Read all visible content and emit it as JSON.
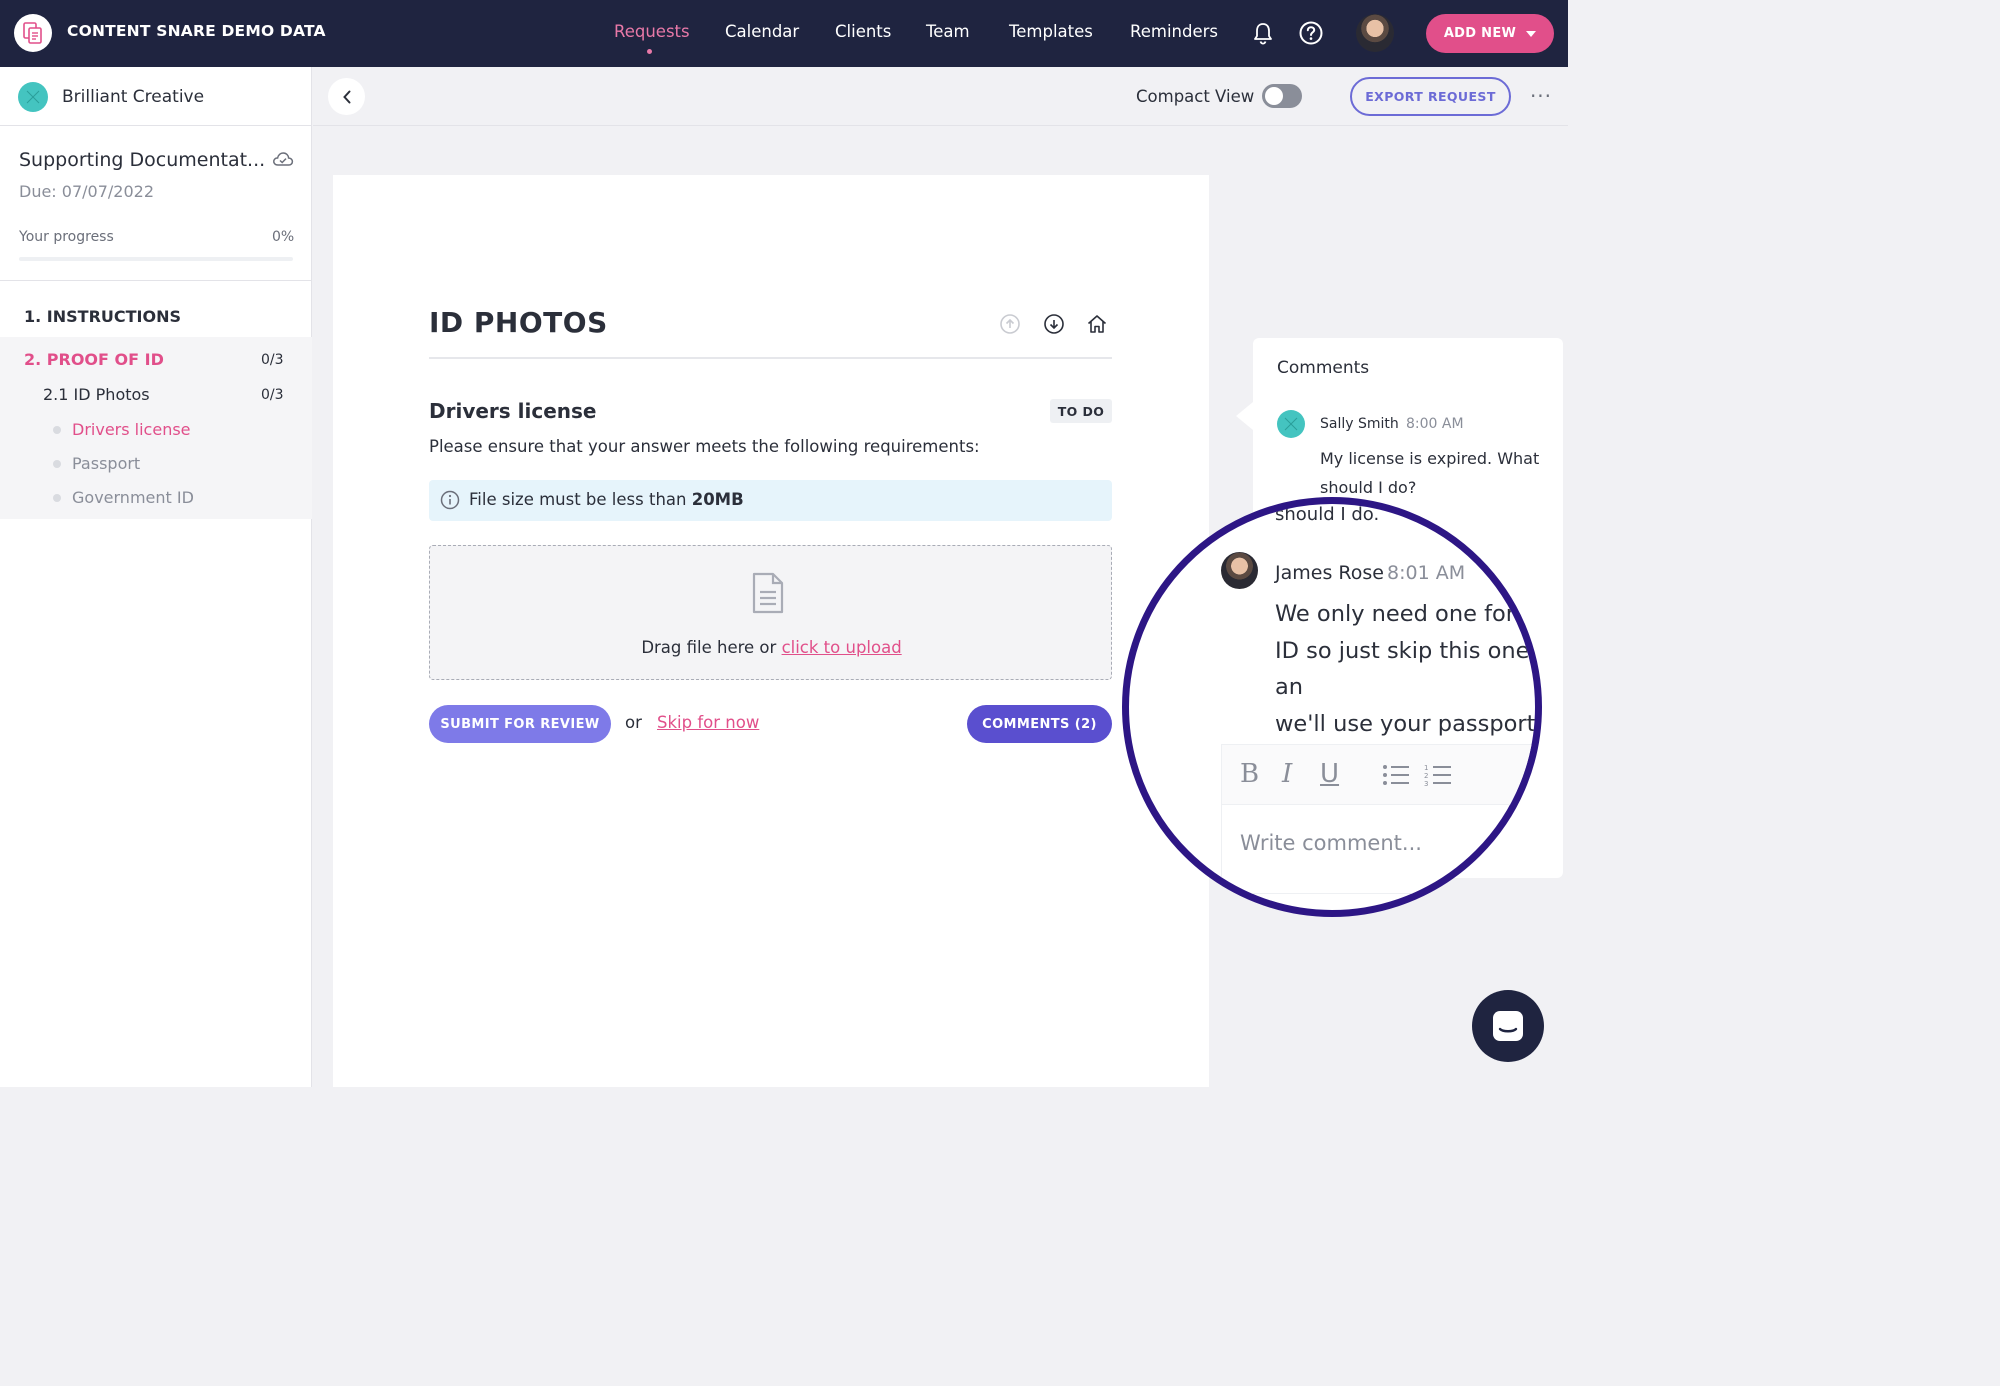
{
  "topnav": {
    "app_title": "CONTENT SNARE DEMO DATA",
    "links": [
      "Requests",
      "Calendar",
      "Clients",
      "Team",
      "Templates",
      "Reminders"
    ],
    "active_link": "Requests",
    "add_new_label": "ADD NEW",
    "icons": [
      "bell-icon",
      "help-icon"
    ]
  },
  "sidebar": {
    "client_name": "Brilliant Creative",
    "request_title": "Supporting Documentat...",
    "due": "Due: 07/07/2022",
    "progress_label": "Your progress",
    "progress_value": "0%",
    "progress_fraction": 0,
    "sections": [
      {
        "label": "1. INSTRUCTIONS"
      },
      {
        "label": "2. PROOF OF ID",
        "count": "0/3",
        "subsections": [
          {
            "label": "2.1 ID Photos",
            "count": "0/3",
            "items": [
              "Drivers license",
              "Passport",
              "Government ID"
            ]
          }
        ]
      }
    ]
  },
  "toolbar": {
    "compact_view_label": "Compact View",
    "compact_view_on": false,
    "export_label": "EXPORT REQUEST",
    "more_label": "···"
  },
  "main": {
    "section_title": "ID PHOTOS",
    "item_title": "Drivers license",
    "status_badge": "TO DO",
    "instructions": "Please ensure that your answer meets the following requirements:",
    "requirement_prefix": "File size must be less than ",
    "requirement_value": "20MB",
    "drop_text": "Drag file here or ",
    "drop_link": "click to upload",
    "submit_label": "SUBMIT FOR REVIEW",
    "or_text": "or",
    "skip_label": "Skip for now",
    "comments_label": "COMMENTS (2)"
  },
  "comments": {
    "title": "Comments",
    "items": [
      {
        "author": "Sally Smith",
        "time": "8:00 AM",
        "text": "My license is expired. What should I do?"
      },
      {
        "author": "James Rose",
        "time": "8:01 AM",
        "text": "We only need one form of ID so just skip this one and we'll use your passport"
      }
    ],
    "magnified": {
      "ghost_line": "should I do.",
      "ghost_time": "M",
      "ghost_right1": "m of",
      "ghost_right2": "nd",
      "text_lines": [
        "We only need one form",
        "ID so just skip this one an",
        "we'll use your passport"
      ]
    },
    "editor_tools": [
      "B",
      "I",
      "U"
    ],
    "placeholder": "Write comment..."
  },
  "colors": {
    "nav_bg": "#1f2440",
    "accent_pink": "#e14f8a",
    "accent_purple": "#6c6bd6",
    "magnifier_ring": "#2d1685",
    "client_avatar": "#44c4c0"
  }
}
